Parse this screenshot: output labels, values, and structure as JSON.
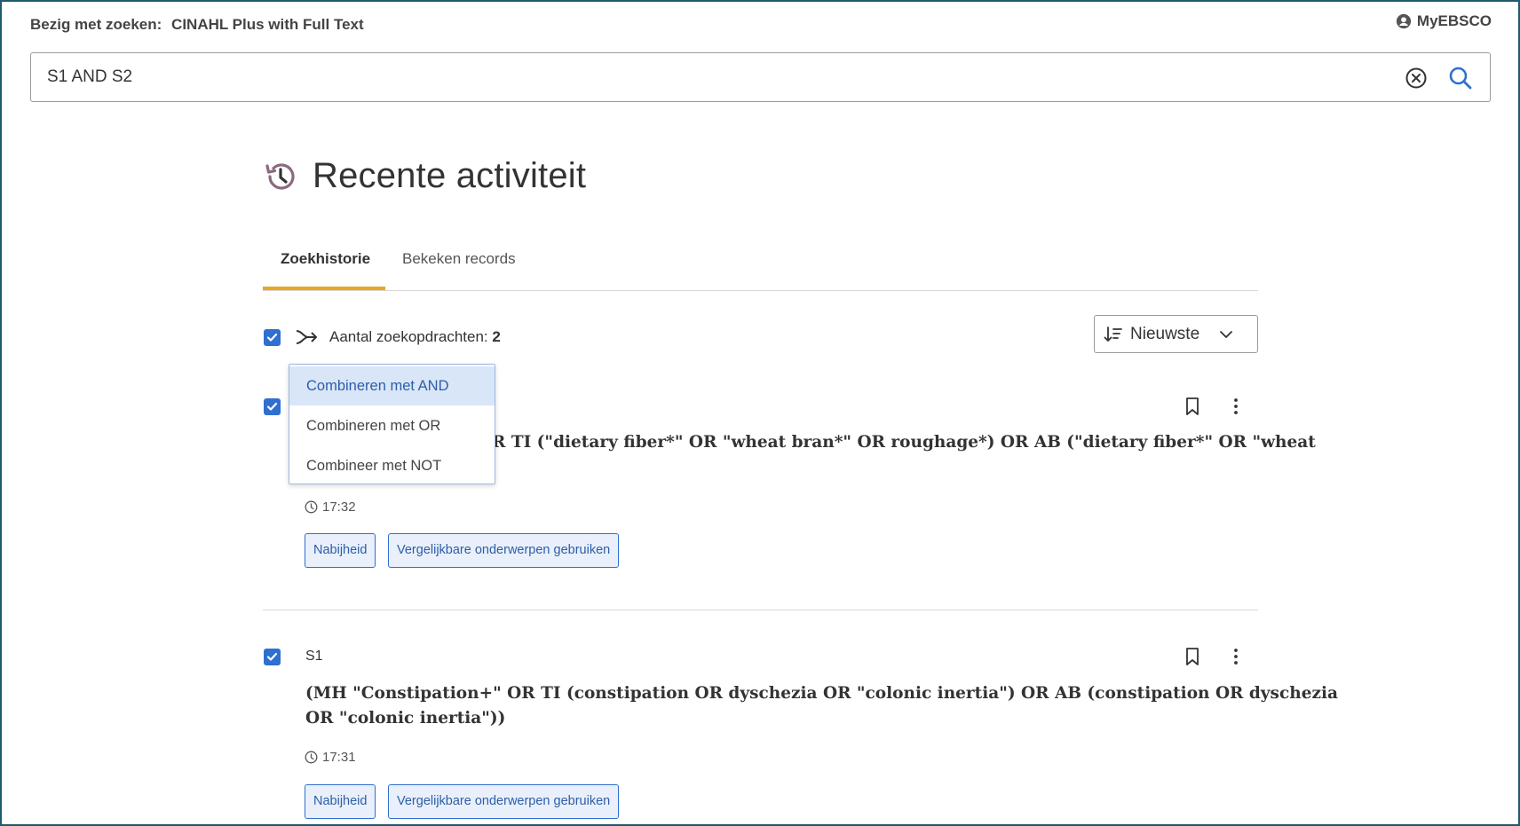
{
  "header": {
    "searching_label": "Bezig met zoeken:",
    "database": "CINAHL Plus with Full Text",
    "account_link": "MyEBSCO"
  },
  "search": {
    "query": "S1 AND S2"
  },
  "page": {
    "title": "Recente activiteit"
  },
  "tabs": [
    {
      "label": "Zoekhistorie",
      "active": true
    },
    {
      "label": "Bekeken records",
      "active": false
    }
  ],
  "summary": {
    "label": "Aantal zoekopdrachten:",
    "count": "2"
  },
  "sort": {
    "label": "Nieuwste"
  },
  "combine_menu": {
    "items": [
      "Combineren met AND",
      "Combineren met OR",
      "Combineer met NOT"
    ],
    "selected": "Combineren met AND"
  },
  "history": [
    {
      "query_visible": "R TI (\"dietary fiber*\" OR \"wheat bran*\" OR roughage*) OR AB (\"dietary fiber*\" OR \"wheat",
      "time": "17:32",
      "actions": [
        "Nabijheid",
        "Vergelijkbare onderwerpen gebruiken"
      ]
    },
    {
      "id": "S1",
      "query_line1": "(MH \"Constipation+\" OR TI (constipation OR dyschezia OR \"colonic inertia\") OR AB (constipation OR dyschezia",
      "query_line2": "OR \"colonic inertia\"))",
      "time": "17:31",
      "actions": [
        "Nabijheid",
        "Vergelijkbare onderwerpen gebruiken"
      ]
    }
  ],
  "colors": {
    "accent_blue": "#2f6fd0",
    "tab_underline": "#e8a623",
    "history_icon": "#8a6a80"
  }
}
